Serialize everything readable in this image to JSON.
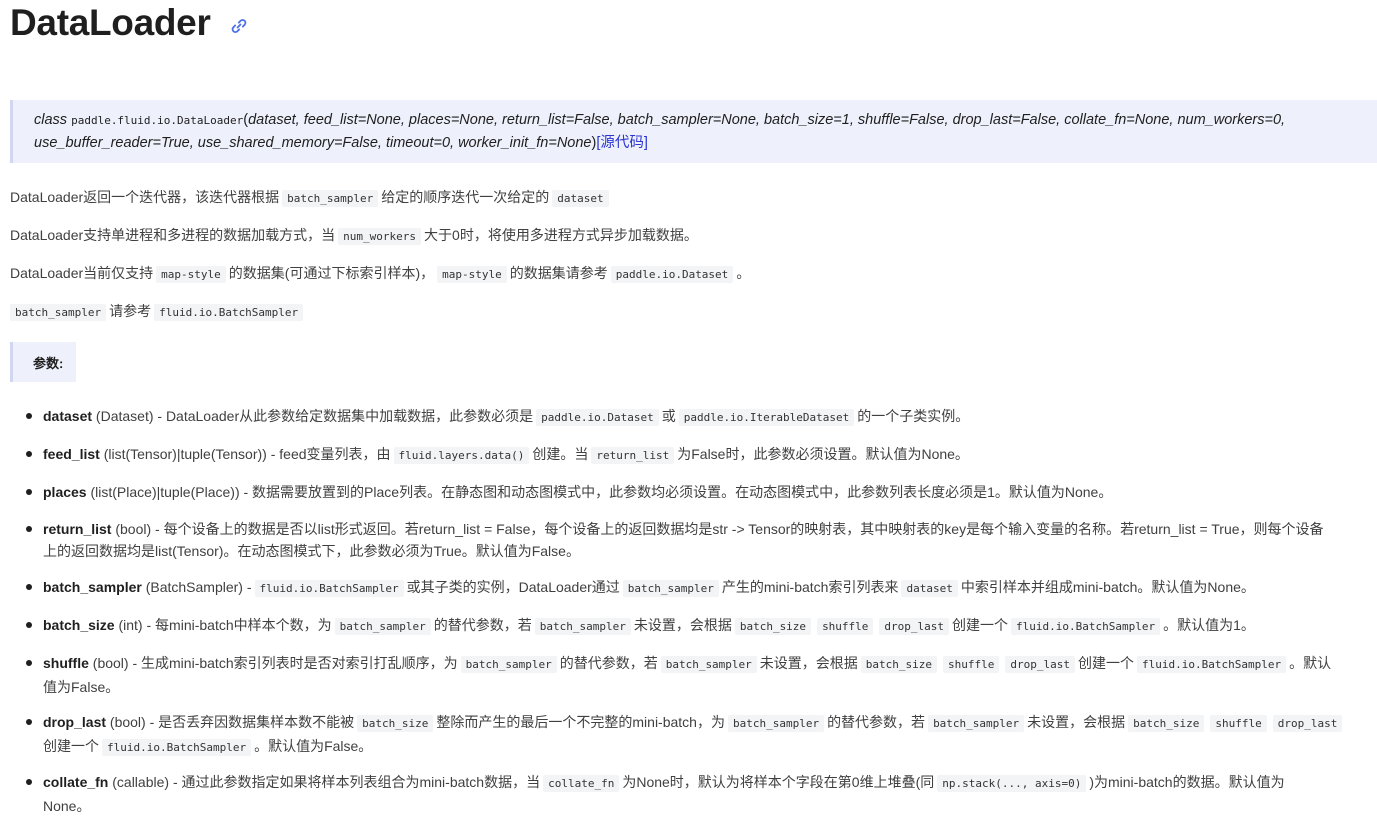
{
  "title": "DataLoader",
  "signature": {
    "keyword": "class",
    "name": "paddle.fluid.io.DataLoader",
    "params_line1": "dataset, feed_list=None, places=None, return_list=False, batch_sampler=None, batch_size=1, shuffle=False, drop_last=False, collate_fn=None, num_workers=0,",
    "params_line2": "use_buffer_reader=True, use_shared_memory=False, timeout=0, worker_init_fn=None",
    "source_link": "[源代码]"
  },
  "paragraphs": {
    "p1": [
      "DataLoader返回一个迭代器，该迭代器根据",
      "batch_sampler",
      "给定的顺序迭代一次给定的",
      "dataset"
    ],
    "p2": [
      "DataLoader支持单进程和多进程的数据加载方式，当",
      "num_workers",
      "大于0时，将使用多进程方式异步加载数据。"
    ],
    "p3": [
      "DataLoader当前仅支持",
      "map-style",
      "的数据集(可通过下标索引样本)，",
      "map-style",
      "的数据集请参考",
      "paddle.io.Dataset",
      "。"
    ],
    "p4": [
      "batch_sampler",
      "请参考",
      "fluid.io.BatchSampler"
    ]
  },
  "params_heading": "参数:",
  "params": {
    "dataset": {
      "name": "dataset",
      "type": "(Dataset)",
      "t1": "- DataLoader从此参数给定数据集中加载数据，此参数必须是",
      "c1": "paddle.io.Dataset",
      "t2": "或",
      "c2": "paddle.io.IterableDataset",
      "t3": "的一个子类实例。"
    },
    "feed_list": {
      "name": "feed_list",
      "type": "(list(Tensor)|tuple(Tensor))",
      "t1": "- feed变量列表，由",
      "c1": "fluid.layers.data()",
      "t2": "创建。当",
      "c2": "return_list",
      "t3": "为False时，此参数必须设置。默认值为None。"
    },
    "places": {
      "name": "places",
      "type": "(list(Place)|tuple(Place))",
      "t1": "- 数据需要放置到的Place列表。在静态图和动态图模式中，此参数均必须设置。在动态图模式中，此参数列表长度必须是1。默认值为None。"
    },
    "return_list": {
      "name": "return_list",
      "type": "(bool)",
      "line1": "- 每个设备上的数据是否以list形式返回。若return_list = False，每个设备上的返回数据均是str -> Tensor的映射表，其中映射表的key是每个输入变量的名称。若return_list = True，则每个设备",
      "line2": "上的返回数据均是list(Tensor)。在动态图模式下，此参数必须为True。默认值为False。"
    },
    "batch_sampler": {
      "name": "batch_sampler",
      "type": "(BatchSampler)",
      "t1": "-",
      "c1": "fluid.io.BatchSampler",
      "t2": "或其子类的实例，DataLoader通过",
      "c2": "batch_sampler",
      "t3": "产生的mini-batch索引列表来",
      "c3": "dataset",
      "t4": "中索引样本并组成mini-batch。默认值为None。"
    },
    "batch_size": {
      "name": "batch_size",
      "type": "(int)",
      "t1": "- 每mini-batch中样本个数，为",
      "c1": "batch_sampler",
      "t2": "的替代参数，若",
      "c2": "batch_sampler",
      "t3": "未设置，会根据",
      "c3": "batch_size",
      "c4": "shuffle",
      "c5": "drop_last",
      "t4": "创建一个",
      "c6": "fluid.io.BatchSampler",
      "t5": "。默认值为1。"
    },
    "shuffle": {
      "name": "shuffle",
      "type": "(bool)",
      "t1": "- 生成mini-batch索引列表时是否对索引打乱顺序，为",
      "c1": "batch_sampler",
      "t2": "的替代参数，若",
      "c2": "batch_sampler",
      "t3": "未设置，会根据",
      "c3": "batch_size",
      "c4": "shuffle",
      "c5": "drop_last",
      "t4": "创建一个",
      "c6": "fluid.io.BatchSampler",
      "t5": "。默认",
      "line2": "值为False。"
    },
    "drop_last": {
      "name": "drop_last",
      "type": "(bool)",
      "t1": "- 是否丢弃因数据集样本数不能被",
      "c1": "batch_size",
      "t2": "整除而产生的最后一个不完整的mini-batch，为",
      "c2": "batch_sampler",
      "t3": "的替代参数，若",
      "c3": "batch_sampler",
      "t4": "未设置，会根据",
      "c4": "batch_size",
      "c5": "shuffle",
      "c6": "drop_last",
      "l2a": "创建一个",
      "l2c": "fluid.io.BatchSampler",
      "l2b": "。默认值为False。"
    },
    "collate_fn": {
      "name": "collate_fn",
      "type": "(callable)",
      "t1": "- 通过此参数指定如果将样本列表组合为mini-batch数据，当",
      "c1": "collate_fn",
      "t2": "为None时，默认为将样本个字段在第0维上堆叠(同",
      "c2": "np.stack(..., axis=0)",
      "t3": ")为mini-batch的数据。默认值为",
      "line2": "None。"
    }
  },
  "colors": {
    "link": "#2934d1",
    "signature_bg": "#eef0fb",
    "code_bg": "#f3f4f5"
  }
}
